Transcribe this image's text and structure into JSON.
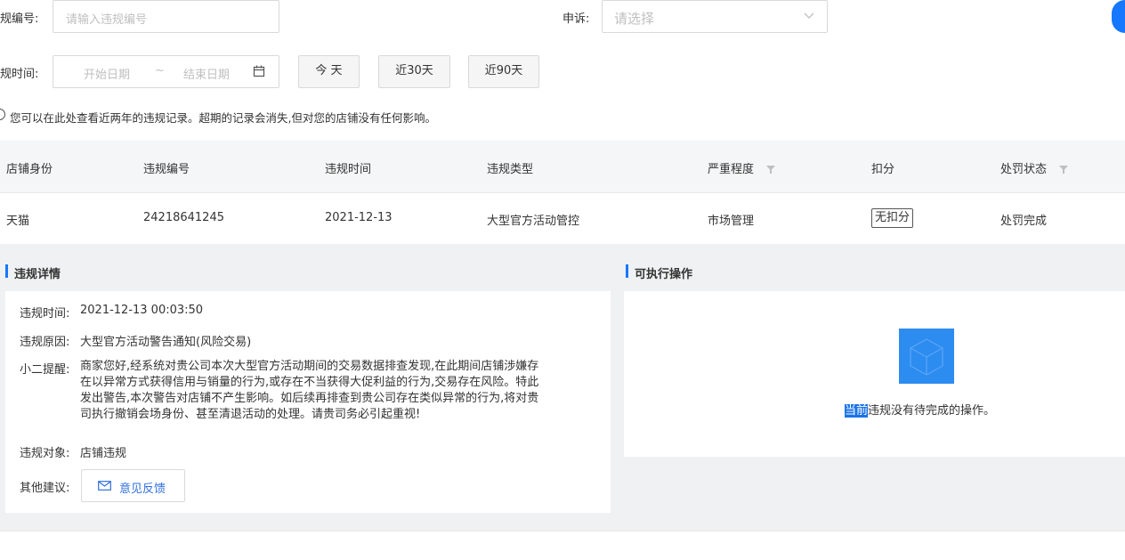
{
  "filters": {
    "violation_no_label": "规编号:",
    "violation_no_placeholder": "请输入违规编号",
    "appeal_label": "申诉:",
    "appeal_placeholder": "请选择",
    "violation_time_label": "规时间:",
    "start_date_placeholder": "开始日期",
    "date_separator": "~",
    "end_date_placeholder": "结束日期",
    "quick_ranges": [
      "今 天",
      "近30天",
      "近90天"
    ]
  },
  "tip": "您可以在此处查看近两年的违规记录。超期的记录会消失,但对您的店铺没有任何影响。",
  "table": {
    "columns": [
      "店铺身份",
      "违规编号",
      "违规时间",
      "违规类型",
      "严重程度",
      "扣分",
      "处罚状态"
    ],
    "rows": [
      {
        "shop_identity": "天猫",
        "violation_no": "24218641245",
        "violation_time": "2021-12-13",
        "violation_type": "大型官方活动管控",
        "severity": "市场管理",
        "deduction": "无扣分",
        "penalty_status": "处罚完成"
      }
    ]
  },
  "detail": {
    "title": "违规详情",
    "time_label": "违规时间:",
    "time_value": "2021-12-13 00:03:50",
    "reason_label": "违规原因:",
    "reason_value": "大型官方活动警告通知(风险交易)",
    "remind_label": "小二提醒:",
    "remind_lines": [
      "商家您好,经系统对贵公司本次大型官方活动期间的交易数据排查发现,在此期间店铺涉嫌存",
      "在以异常方式获得信用与销量的行为,或存在不当获得大促利益的行为,交易存在风险。特此",
      "发出警告,本次警告对店铺不产生影响。如后续再排查到贵公司存在类似异常的行为,将对贵",
      "司执行撤销会场身份、甚至清退活动的处理。请贵司务必引起重视!"
    ],
    "target_label": "违规对象:",
    "target_value": "店铺违规",
    "suggestion_label": "其他建议:",
    "feedback_button": "意见反馈"
  },
  "actions": {
    "title": "可执行操作",
    "empty_highlight": "当前",
    "empty_rest": "违规没有待完成的操作。"
  },
  "colors": {
    "accent": "#1677ff",
    "table_header_bg": "#f5f6f7",
    "detail_bg": "#f0f1f2"
  }
}
